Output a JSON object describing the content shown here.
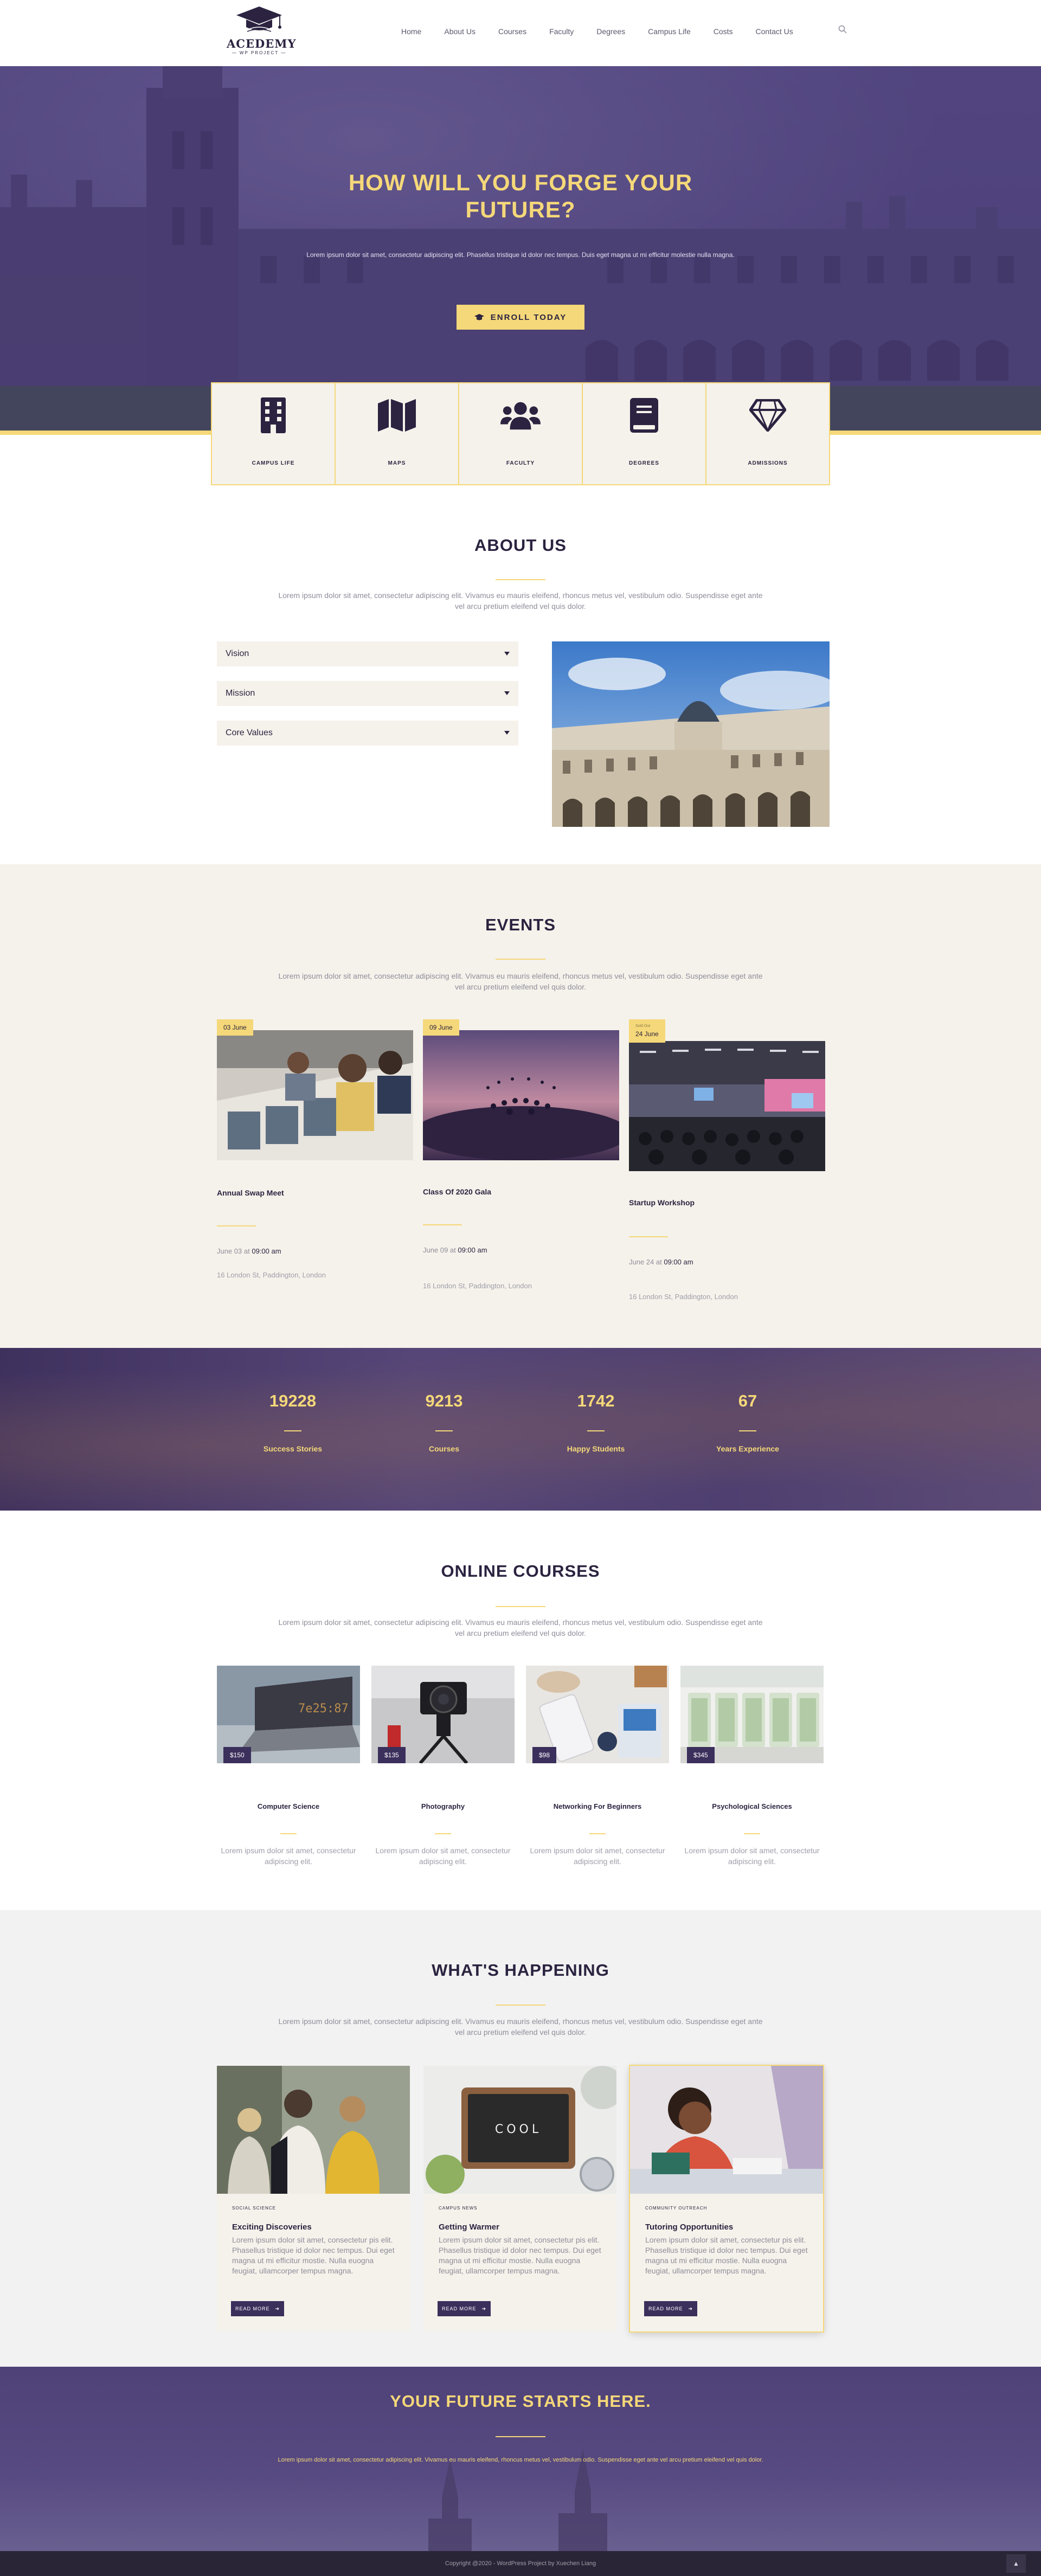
{
  "site": {
    "logo_name": "ACEDEMY",
    "logo_sub": "— WP PROJECT —",
    "nav": [
      "Home",
      "About Us",
      "Courses",
      "Faculty",
      "Degrees",
      "Campus Life",
      "Costs",
      "Contact Us"
    ],
    "search_icon": "search-icon"
  },
  "hero": {
    "title": "HOW WILL YOU FORGE YOUR FUTURE?",
    "text": "Lorem ipsum dolor sit amet, consectetur adipiscing elit. Phasellus tristique id dolor nec tempus. Duis eget magna ut mi efficitur molestie nulla magna.",
    "button_label": "ENROLL TODAY",
    "button_icon": "graduation-cap-icon"
  },
  "features": [
    {
      "label": "CAMPUS LIFE",
      "icon": "building-icon"
    },
    {
      "label": "MAPS",
      "icon": "map-icon"
    },
    {
      "label": "FACULTY",
      "icon": "users-icon"
    },
    {
      "label": "DEGREES",
      "icon": "book-icon"
    },
    {
      "label": "ADMISSIONS",
      "icon": "diamond-icon"
    }
  ],
  "about": {
    "title": "ABOUT US",
    "text": "Lorem ipsum dolor sit amet, consectetur adipiscing elit. Vivamus eu mauris eleifend, rhoncus metus vel, vestibulum odio. Suspendisse eget ante vel arcu pretium eleifend vel quis dolor.",
    "accordion": [
      "Vision",
      "Mission",
      "Core Values"
    ]
  },
  "events": {
    "title": "EVENTS",
    "text": "Lorem ipsum dolor sit amet, consectetur adipiscing elit. Vivamus eu mauris eleifend, rhoncus metus vel, vestibulum odio. Suspendisse eget ante vel arcu pretium eleifend vel quis dolor.",
    "items": [
      {
        "badge": "03 June",
        "badge_top": "",
        "title": "Annual Swap Meet",
        "date": "June 03",
        "at": "at",
        "time": "09:00 am",
        "location": "16 London St, Paddington, London"
      },
      {
        "badge": "09 June",
        "badge_top": "",
        "title": "Class Of 2020 Gala",
        "date": "June 09",
        "at": "at",
        "time": "09:00 am",
        "location": "16 London St, Paddington, London"
      },
      {
        "badge": "24 June",
        "badge_top": "Sold Out",
        "title": "Startup Workshop",
        "date": "June 24",
        "at": "at",
        "time": "09:00 am",
        "location": "16 London St, Paddington, London"
      }
    ]
  },
  "stats": [
    {
      "value": "19228",
      "label": "Success Stories"
    },
    {
      "value": "9213",
      "label": "Courses"
    },
    {
      "value": "1742",
      "label": "Happy Students"
    },
    {
      "value": "67",
      "label": "Years Experience"
    }
  ],
  "courses": {
    "title": "ONLINE COURSES",
    "text": "Lorem ipsum dolor sit amet, consectetur adipiscing elit. Vivamus eu mauris eleifend, rhoncus metus vel, vestibulum odio. Suspendisse eget ante vel arcu pretium eleifend vel quis dolor.",
    "items": [
      {
        "price": "$150",
        "title": "Computer Science",
        "text": "Lorem ipsum dolor sit amet, consectetur adipiscing elit."
      },
      {
        "price": "$135",
        "title": "Photography",
        "text": "Lorem ipsum dolor sit amet, consectetur adipiscing elit."
      },
      {
        "price": "$98",
        "title": "Networking For Beginners",
        "text": "Lorem ipsum dolor sit amet, consectetur adipiscing elit."
      },
      {
        "price": "$345",
        "title": "Psychological Sciences",
        "text": "Lorem ipsum dolor sit amet, consectetur adipiscing elit."
      }
    ]
  },
  "happening": {
    "title": "WHAT'S HAPPENING",
    "text": "Lorem ipsum dolor sit amet, consectetur adipiscing elit. Vivamus eu mauris eleifend, rhoncus metus vel, vestibulum odio. Suspendisse eget ante vel arcu pretium eleifend vel quis dolor.",
    "cards": [
      {
        "tag": "SOCIAL SCIENCE",
        "title": "Exciting Discoveries",
        "text": "Lorem ipsum dolor sit amet, consectetur pis elit. Phasellus tristique id dolor nec tempus. Dui eget magna ut mi efficitur mostie. Nulla euogna feugiat, ullamcorper tempus magna.",
        "button": "READ MORE"
      },
      {
        "tag": "CAMPUS NEWS",
        "title": "Getting Warmer",
        "text": "Lorem ipsum dolor sit amet, consectetur pis elit. Phasellus tristique id dolor nec tempus. Dui eget magna ut mi efficitur mostie. Nulla euogna feugiat, ullamcorper tempus magna.",
        "button": "READ MORE",
        "board_text": "COOL"
      },
      {
        "tag": "COMMUNITY OUTREACH",
        "title": "Tutoring Opportunities",
        "text": "Lorem ipsum dolor sit amet, consectetur pis elit. Phasellus tristique id dolor nec tempus. Dui eget magna ut mi efficitur mostie. Nulla euogna feugiat, ullamcorper tempus magna.",
        "button": "READ MORE"
      }
    ]
  },
  "cta": {
    "title": "YOUR FUTURE STARTS HERE.",
    "text": "Lorem ipsum dolor sit amet, consectetur adipiscing elit. Vivamus eu mauris eleifend, rhoncus metus vel, vestibulum odio. Suspendisse eget ante vel arcu pretium eleifend vel quis dolor."
  },
  "footer": {
    "copyright": "Copyright @2020 - WordPress Project by Xuechen Liang",
    "to_top_icon": "chevron-up-icon"
  },
  "colors": {
    "accent": "#f5d879",
    "primary": "#2b2340",
    "purple": "#3b2f5c",
    "cream": "#f5f2eb"
  }
}
